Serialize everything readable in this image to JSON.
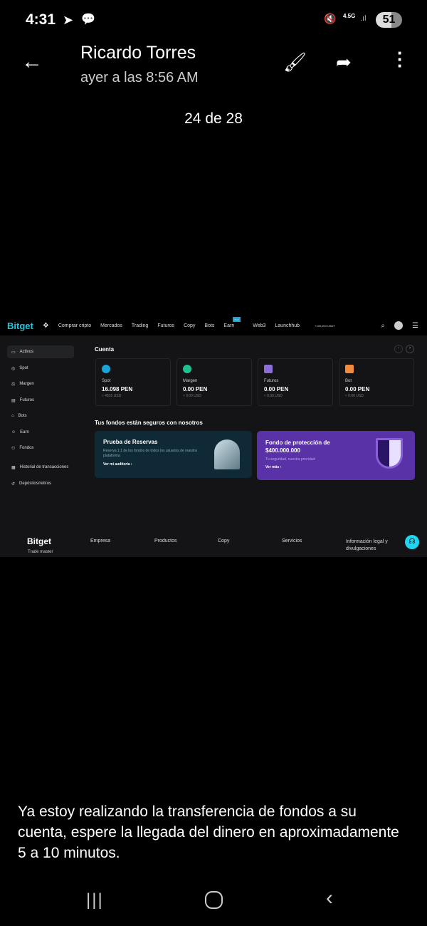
{
  "status": {
    "time": "4:31",
    "network": "4.5G",
    "battery": "51"
  },
  "header": {
    "name": "Ricardo Torres",
    "subtitle": "ayer a las 8:56 AM",
    "counter": "24 de 28"
  },
  "bitget": {
    "logo": "Bitget",
    "nav": [
      "Comprar cripto",
      "Mercados",
      "Trading",
      "Futuros",
      "Copy",
      "Bots",
      "Earn",
      "Web3",
      "Launchhub"
    ],
    "hot_badge": "Hot",
    "promo": "+100,000 USDT",
    "sidebar": [
      "Activos",
      "Spot",
      "Margen",
      "Futuros",
      "Bots",
      "Earn",
      "Fondos",
      "Historial de transacciones",
      "Depósitos/retiros"
    ],
    "section_title": "Cuenta",
    "cards": [
      {
        "label": "Spot",
        "value": "16.098 PEN",
        "usd": "≈ 4531 USD",
        "color": "#1aa3d6"
      },
      {
        "label": "Margen",
        "value": "0.00 PEN",
        "usd": "≈ 0.00 USD",
        "color": "#1fbf8f"
      },
      {
        "label": "Futuros",
        "value": "0.00 PEN",
        "usd": "≈ 0.00 USD",
        "color": "#8c6fd6"
      },
      {
        "label": "Bot",
        "value": "0.00 PEN",
        "usd": "≈ 0.00 USD",
        "color": "#f08a3c"
      }
    ],
    "safe_title": "Tus fondos están seguros con nosotros",
    "reserves": {
      "title": "Prueba de Reservas",
      "desc": "Reserva 1:1 de los fondos de todos los usuarios de nuestra plataforma",
      "link": "Ver mi auditoría ›"
    },
    "protection": {
      "title": "Fondo de protección de $400.000.000",
      "desc": "Tu seguridad, nuestra prioridad",
      "link": "Ver más ›"
    },
    "footer": {
      "logo": "Bitget",
      "tagline": "Trade master",
      "cols": [
        "Empresa",
        "Productos",
        "Copy",
        "Servicios",
        "Información legal y divulgaciones"
      ]
    }
  },
  "message": "Ya estoy realizando la transferencia de fondos a su cuenta, espere la llegada del dinero en aproximadamente 5 a 10 minutos."
}
